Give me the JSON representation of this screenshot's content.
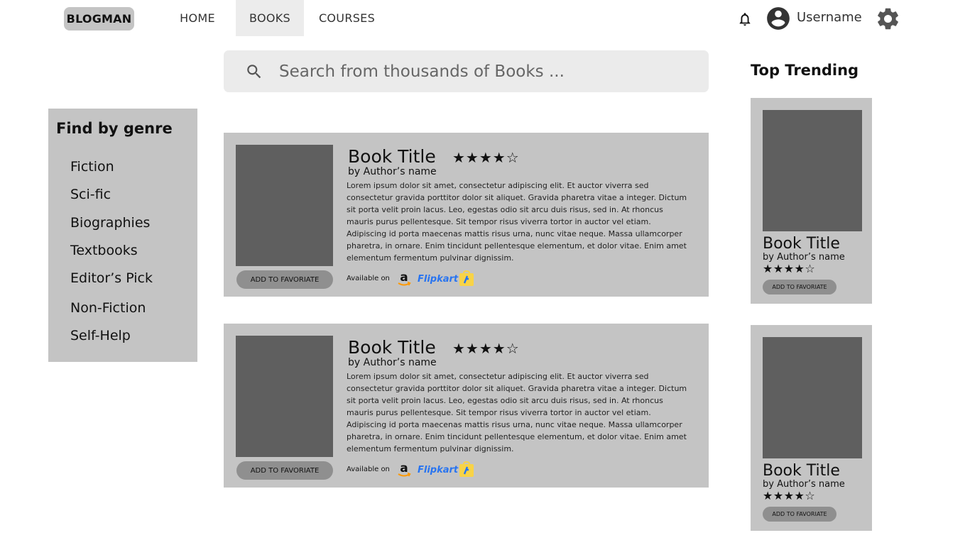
{
  "header": {
    "logo": "BLOGMAN",
    "nav": [
      {
        "label": "HOME",
        "active": false
      },
      {
        "label": "BOOKS",
        "active": true
      },
      {
        "label": "COURSES",
        "active": false
      }
    ],
    "username": "Username",
    "icons": [
      "bell-icon",
      "avatar-icon",
      "gear-icon"
    ]
  },
  "search": {
    "placeholder": "Search from thousands of Books ...",
    "icon": "search-icon"
  },
  "sidebar": {
    "title": "Find by genre",
    "items": [
      "Fiction",
      "Sci-fic",
      "Biographies",
      "Textbooks",
      "Editor’s Pick",
      "Non-Fiction",
      "Self-Help"
    ]
  },
  "books": [
    {
      "title": "Book Title",
      "author": "by Author’s name",
      "rating": 4,
      "rating_max": 5,
      "stars": "★★★★☆",
      "description": "Lorem ipsum dolor sit amet, consectetur adipiscing elit. Et auctor viverra sed consectetur gravida porttitor dolor sit aliquet. Gravida pharetra vitae a integer. Dictum sit porta velit proin lacus. Leo, egestas odio sit arcu duis risus, sed in. At rhoncus mauris purus pellentesque. Sit tempor risus viverra tortor in auctor vel etiam. Adipiscing id porta maecenas mattis risus urna, nunc vitae neque. Massa ullamcorper pharetra, in ornare. Enim tincidunt pellentesque elementum, et dolor vitae. Enim amet elementum fermentum pulvinar dignissim.",
      "fav_label": "ADD TO FAVORIATE",
      "available_label": "Available on",
      "flipkart_label": "Flipkart"
    },
    {
      "title": "Book Title",
      "author": "by Author’s name",
      "rating": 4,
      "rating_max": 5,
      "stars": "★★★★☆",
      "description": "Lorem ipsum dolor sit amet, consectetur adipiscing elit. Et auctor viverra sed consectetur gravida porttitor dolor sit aliquet. Gravida pharetra vitae a integer. Dictum sit porta velit proin lacus. Leo, egestas odio sit arcu duis risus, sed in. At rhoncus mauris purus pellentesque. Sit tempor risus viverra tortor in auctor vel etiam. Adipiscing id porta maecenas mattis risus urna, nunc vitae neque. Massa ullamcorper pharetra, in ornare. Enim tincidunt pellentesque elementum, et dolor vitae. Enim amet elementum fermentum pulvinar dignissim.",
      "fav_label": "ADD TO FAVORIATE",
      "available_label": "Available on",
      "flipkart_label": "Flipkart"
    }
  ],
  "trending": {
    "title": "Top Trending",
    "items": [
      {
        "title": "Book Title",
        "author": "by Author’s name",
        "rating": 4,
        "stars": "★★★★☆",
        "fav_label": "ADD TO FAVORIATE"
      },
      {
        "title": "Book Title",
        "author": "by Author’s name",
        "rating": 4,
        "stars": "★★★★☆",
        "fav_label": "ADD TO FAVORIATE"
      }
    ]
  },
  "colors": {
    "panel": "#c4c4c4",
    "cover": "#5f5f5f",
    "button": "#8f8f8f",
    "search_bg": "#ebebeb",
    "active_nav": "#ececec",
    "amazon_orange": "#ff9900",
    "flipkart_blue": "#2874f0",
    "flipkart_yellow": "#f8d347"
  }
}
